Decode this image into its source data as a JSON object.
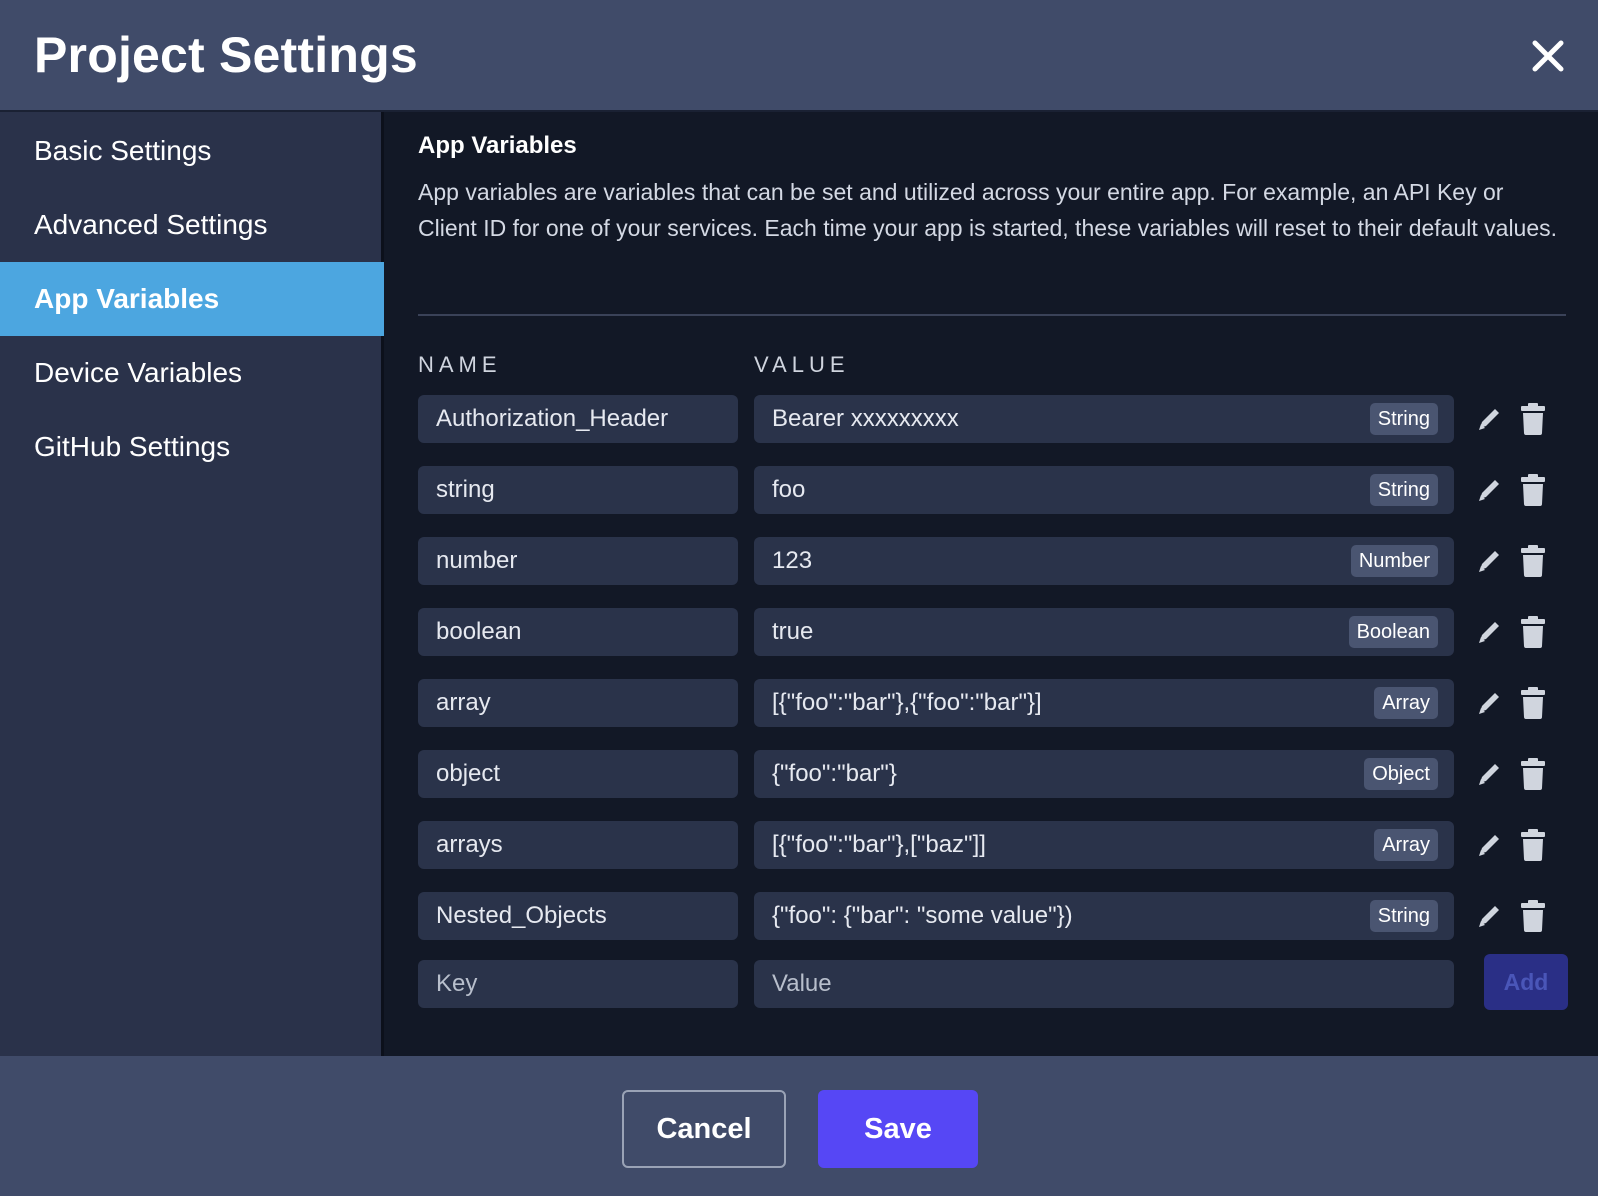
{
  "modal": {
    "title": "Project Settings"
  },
  "sidebar": {
    "items": [
      {
        "label": "Basic Settings",
        "active": false
      },
      {
        "label": "Advanced Settings",
        "active": false
      },
      {
        "label": "App Variables",
        "active": true
      },
      {
        "label": "Device Variables",
        "active": false
      },
      {
        "label": "GitHub Settings",
        "active": false
      }
    ]
  },
  "section": {
    "title": "App Variables",
    "description": "App variables are variables that can be set and utilized across your entire app. For example, an API Key or Client ID for one of your services. Each time your app is started, these variables will reset to their default values."
  },
  "table": {
    "headers": {
      "name": "NAME",
      "value": "VALUE"
    },
    "rows": [
      {
        "name": "Authorization_Header",
        "value": "Bearer xxxxxxxxx",
        "type": "String"
      },
      {
        "name": "string",
        "value": "foo",
        "type": "String"
      },
      {
        "name": "number",
        "value": "123",
        "type": "Number"
      },
      {
        "name": "boolean",
        "value": "true",
        "type": "Boolean"
      },
      {
        "name": "array",
        "value": "[{\"foo\":\"bar\"},{\"foo\":\"bar\"}]",
        "type": "Array"
      },
      {
        "name": "object",
        "value": "{\"foo\":\"bar\"}",
        "type": "Object"
      },
      {
        "name": "arrays",
        "value": "[{\"foo\":\"bar\"},[\"baz\"]]",
        "type": "Array"
      },
      {
        "name": "Nested_Objects",
        "value": "{\"foo\": {\"bar\": \"some value\"})",
        "type": "String"
      }
    ],
    "new_row": {
      "key_placeholder": "Key",
      "value_placeholder": "Value",
      "add_label": "Add"
    }
  },
  "footer": {
    "cancel_label": "Cancel",
    "save_label": "Save"
  },
  "icons": {
    "close": "close-icon",
    "edit": "pencil-icon",
    "delete": "trash-icon"
  },
  "colors": {
    "header_bg": "#404b69",
    "sidebar_bg": "#2a324a",
    "sidebar_active": "#4ca6e0",
    "content_bg": "#121826",
    "field_bg": "#2a334a",
    "badge_bg": "#4a5571",
    "save_button": "#5647f5",
    "add_button_disabled": "#2a2f86"
  }
}
